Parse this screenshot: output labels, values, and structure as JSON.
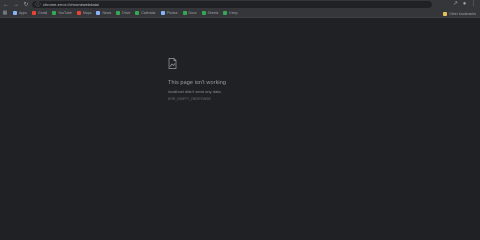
{
  "browser": {
    "url": "chrome-error://chromewebdata/",
    "nav": {
      "back_icon": "arrow-left-icon",
      "forward_icon": "arrow-right-icon",
      "reload_icon": "reload-icon",
      "home_icon": "home-icon"
    },
    "right_icons": [
      "share-icon",
      "star-icon",
      "profile-icon",
      "menu-icon"
    ]
  },
  "bookmarks": [
    {
      "label": "Apps",
      "color": "#8ab4f8"
    },
    {
      "label": "Gmail",
      "color": "#ea4335"
    },
    {
      "label": "YouTube",
      "color": "#34a853"
    },
    {
      "label": "Maps",
      "color": "#ea4335"
    },
    {
      "label": "News",
      "color": "#8ab4f8"
    },
    {
      "label": "Drive",
      "color": "#34a853"
    },
    {
      "label": "Calendar",
      "color": "#34a853"
    },
    {
      "label": "Photos",
      "color": "#8ab4f8"
    },
    {
      "label": "Docs",
      "color": "#34a853"
    },
    {
      "label": "Sheets",
      "color": "#34a853"
    },
    {
      "label": "Keep",
      "color": "#34a853"
    }
  ],
  "other_bookmarks_label": "Other bookmarks",
  "error": {
    "icon": "broken-page-icon",
    "title": "This page isn't working",
    "description": "localhost didn't send any data.",
    "code": "ERR_EMPTY_RESPONSE"
  }
}
